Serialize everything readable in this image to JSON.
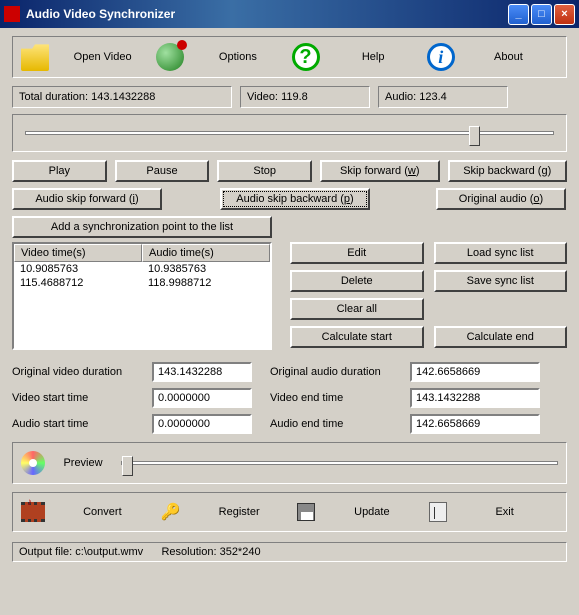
{
  "title": "Audio Video Synchronizer",
  "toolbar": {
    "open_video": "Open Video",
    "options": "Options",
    "help": "Help",
    "about": "About"
  },
  "durations": {
    "total_label": "Total duration:",
    "total_value": "143.1432288",
    "video_label": "Video:",
    "video_value": "119.8",
    "audio_label": "Audio:",
    "audio_value": "123.4"
  },
  "playback": {
    "play": "Play",
    "pause": "Pause",
    "stop": "Stop",
    "skip_forward": "Skip forward (w)",
    "skip_backward": "Skip backward (g)",
    "audio_skip_forward": "Audio skip forward (i)",
    "audio_skip_backward": "Audio skip backward (p)",
    "original_audio": "Original audio (o)"
  },
  "sync": {
    "add_point": "Add a synchronization point to the list",
    "col_video": "Video time(s)",
    "col_audio": "Audio time(s)",
    "rows": [
      {
        "video": "10.9085763",
        "audio": "10.9385763"
      },
      {
        "video": "115.4688712",
        "audio": "118.9988712"
      }
    ],
    "edit": "Edit",
    "delete": "Delete",
    "clear_all": "Clear all",
    "calc_start": "Calculate start",
    "load": "Load sync list",
    "save": "Save sync list",
    "calc_end": "Calculate end"
  },
  "times": {
    "orig_video_dur_label": "Original video duration",
    "orig_video_dur": "143.1432288",
    "video_start_label": "Video start time",
    "video_start": "0.0000000",
    "audio_start_label": "Audio start time",
    "audio_start": "0.0000000",
    "orig_audio_dur_label": "Original audio duration",
    "orig_audio_dur": "142.6658669",
    "video_end_label": "Video end time",
    "video_end": "143.1432288",
    "audio_end_label": "Audio end time",
    "audio_end": "142.6658669"
  },
  "preview": "Preview",
  "bottom": {
    "convert": "Convert",
    "register": "Register",
    "update": "Update",
    "exit": "Exit"
  },
  "status": {
    "output_label": "Output file:",
    "output_value": "c:\\output.wmv",
    "res_label": "Resolution:",
    "res_value": "352*240"
  }
}
